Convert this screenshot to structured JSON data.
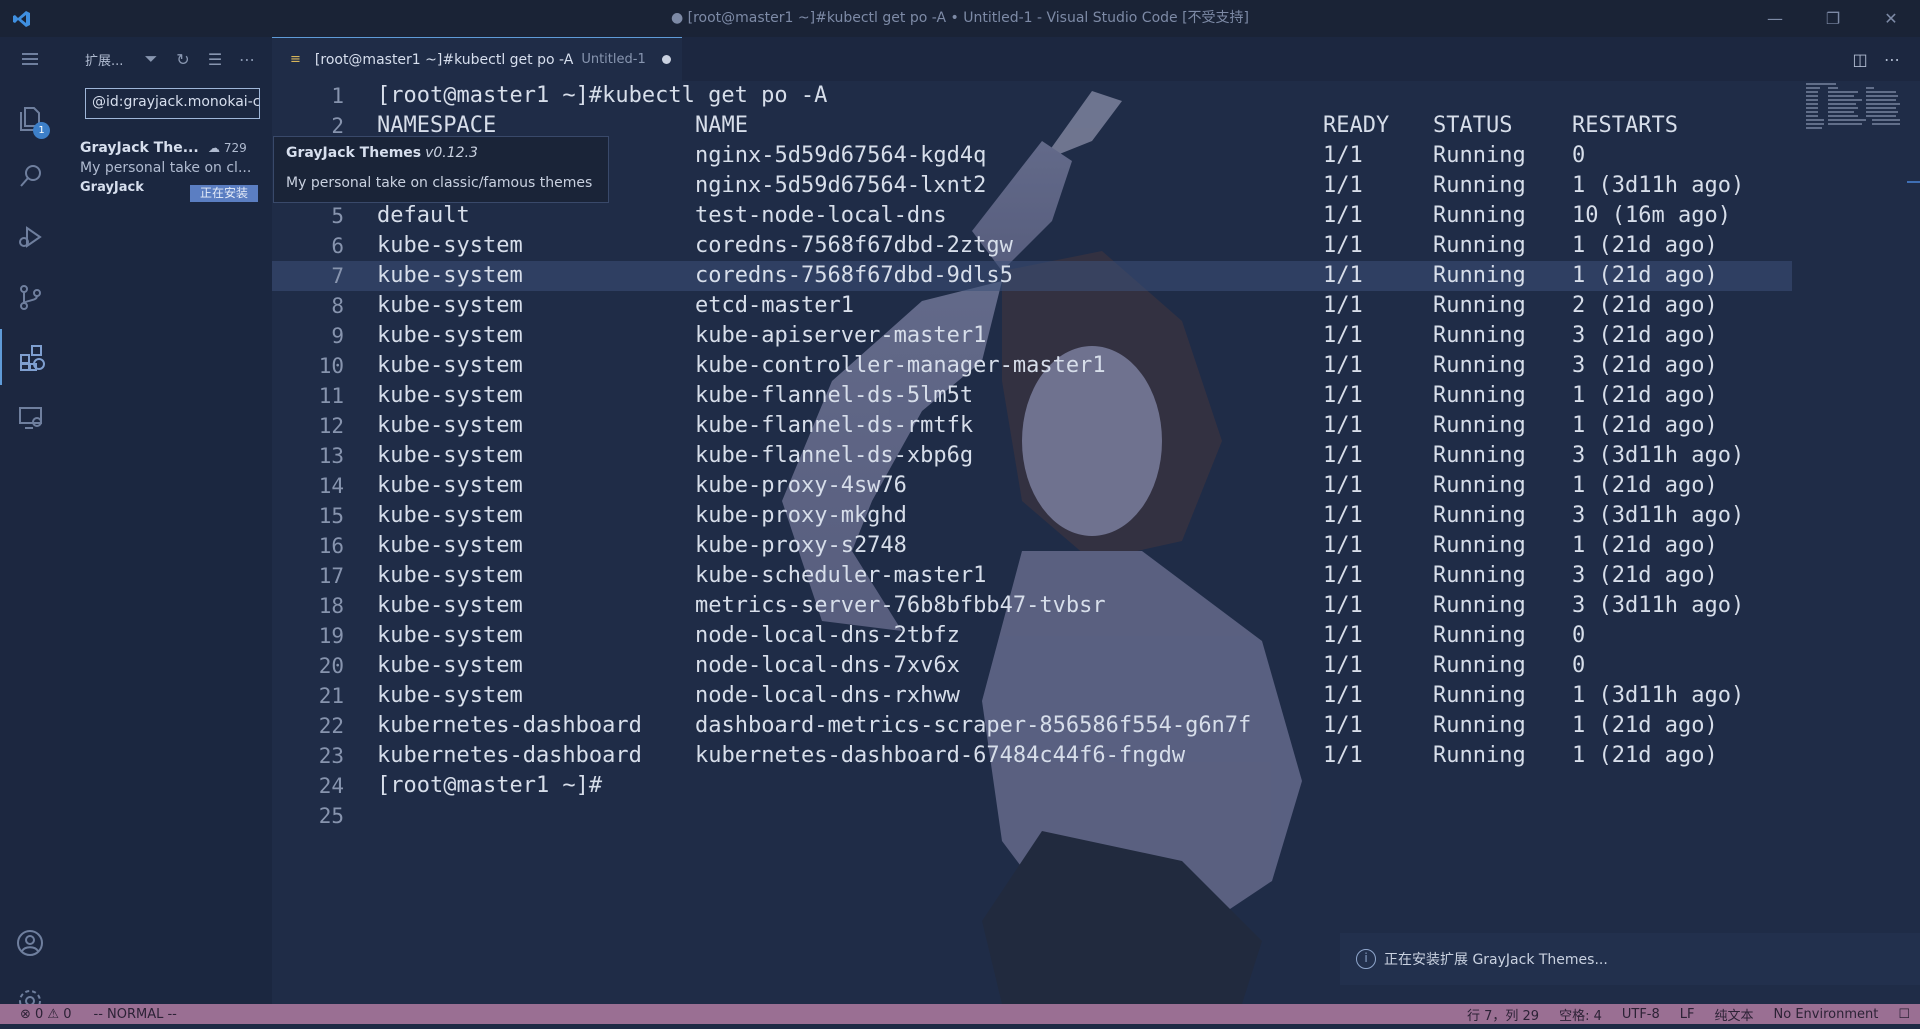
{
  "window": {
    "title": "● [root@master1 ~]#kubectl get po -A • Untitled-1 - Visual Studio Code [不受支持]",
    "minimize": "—",
    "restore": "❐",
    "close": "✕"
  },
  "activity": {
    "explorer_badge": "1"
  },
  "sidebar": {
    "title": "扩展...",
    "search_value": "@id:grayjack.monokai-c",
    "extension": {
      "name": "GrayJack The...",
      "downloads": "729",
      "description": "My personal take on cl...",
      "publisher": "GrayJack",
      "install_status": "正在安装"
    }
  },
  "tooltip": {
    "name": "GrayJack Themes",
    "version": "v0.12.3",
    "description": "My personal take on classic/famous themes"
  },
  "tab": {
    "label": "[root@master1 ~]#kubectl get po -A",
    "sub": "Untitled-1"
  },
  "editor": {
    "current_line": 7,
    "lines": [
      {
        "n": "1",
        "cols": [
          "[root@master1 ~]#kubectl get po -A",
          "",
          "",
          "",
          ""
        ]
      },
      {
        "n": "2",
        "cols": [
          "NAMESPACE",
          "NAME",
          "READY",
          "STATUS",
          "RESTARTS"
        ]
      },
      {
        "n": "3",
        "cols": [
          "",
          "nginx-5d59d67564-kgd4q",
          "1/1",
          "Running",
          "0"
        ]
      },
      {
        "n": "4",
        "cols": [
          "",
          "nginx-5d59d67564-lxnt2",
          "1/1",
          "Running",
          "1 (3d11h ago)"
        ]
      },
      {
        "n": "5",
        "cols": [
          "default",
          "test-node-local-dns",
          "1/1",
          "Running",
          "10 (16m ago)"
        ]
      },
      {
        "n": "6",
        "cols": [
          "kube-system",
          "coredns-7568f67dbd-2ztgw",
          "1/1",
          "Running",
          "1 (21d ago)"
        ]
      },
      {
        "n": "7",
        "cols": [
          "kube-system",
          "coredns-7568f67dbd-9dls5",
          "1/1",
          "Running",
          "1 (21d ago)"
        ]
      },
      {
        "n": "8",
        "cols": [
          "kube-system",
          "etcd-master1",
          "1/1",
          "Running",
          "2 (21d ago)"
        ]
      },
      {
        "n": "9",
        "cols": [
          "kube-system",
          "kube-apiserver-master1",
          "1/1",
          "Running",
          "3 (21d ago)"
        ]
      },
      {
        "n": "10",
        "cols": [
          "kube-system",
          "kube-controller-manager-master1",
          "1/1",
          "Running",
          "3 (21d ago)"
        ]
      },
      {
        "n": "11",
        "cols": [
          "kube-system",
          "kube-flannel-ds-5lm5t",
          "1/1",
          "Running",
          "1 (21d ago)"
        ]
      },
      {
        "n": "12",
        "cols": [
          "kube-system",
          "kube-flannel-ds-rmtfk",
          "1/1",
          "Running",
          "1 (21d ago)"
        ]
      },
      {
        "n": "13",
        "cols": [
          "kube-system",
          "kube-flannel-ds-xbp6g",
          "1/1",
          "Running",
          "3 (3d11h ago)"
        ]
      },
      {
        "n": "14",
        "cols": [
          "kube-system",
          "kube-proxy-4sw76",
          "1/1",
          "Running",
          "1 (21d ago)"
        ]
      },
      {
        "n": "15",
        "cols": [
          "kube-system",
          "kube-proxy-mkghd",
          "1/1",
          "Running",
          "3 (3d11h ago)"
        ]
      },
      {
        "n": "16",
        "cols": [
          "kube-system",
          "kube-proxy-s2748",
          "1/1",
          "Running",
          "1 (21d ago)"
        ]
      },
      {
        "n": "17",
        "cols": [
          "kube-system",
          "kube-scheduler-master1",
          "1/1",
          "Running",
          "3 (21d ago)"
        ]
      },
      {
        "n": "18",
        "cols": [
          "kube-system",
          "metrics-server-76b8bfbb47-tvbsr",
          "1/1",
          "Running",
          "3 (3d11h ago)"
        ]
      },
      {
        "n": "19",
        "cols": [
          "kube-system",
          "node-local-dns-2tbfz",
          "1/1",
          "Running",
          "0"
        ]
      },
      {
        "n": "20",
        "cols": [
          "kube-system",
          "node-local-dns-7xv6x",
          "1/1",
          "Running",
          "0"
        ]
      },
      {
        "n": "21",
        "cols": [
          "kube-system",
          "node-local-dns-rxhww",
          "1/1",
          "Running",
          "1 (3d11h ago)"
        ]
      },
      {
        "n": "22",
        "cols": [
          "kubernetes-dashboard",
          "dashboard-metrics-scraper-856586f554-g6n7f",
          "1/1",
          "Running",
          "1 (21d ago)"
        ]
      },
      {
        "n": "23",
        "cols": [
          "kubernetes-dashboard",
          "kubernetes-dashboard-67484c44f6-fngdw",
          "1/1",
          "Running",
          "1 (21d ago)"
        ]
      },
      {
        "n": "24",
        "cols": [
          "[root@master1 ~]#",
          "",
          "",
          "",
          ""
        ]
      },
      {
        "n": "25",
        "cols": [
          "",
          "",
          "",
          "",
          ""
        ]
      }
    ]
  },
  "notification": {
    "text": "正在安装扩展 GrayJack Themes..."
  },
  "status": {
    "problems": "⊗ 0 ⚠ 0",
    "mode": "-- NORMAL --",
    "position": "行 7，列 29",
    "spaces": "空格: 4",
    "encoding": "UTF-8",
    "eol": "LF",
    "language": "纯文本",
    "environment": "No Environment"
  },
  "colors": {
    "accent": "#5f9bd8",
    "statusbar": "#9a6f93",
    "background": "#1f2c47"
  }
}
